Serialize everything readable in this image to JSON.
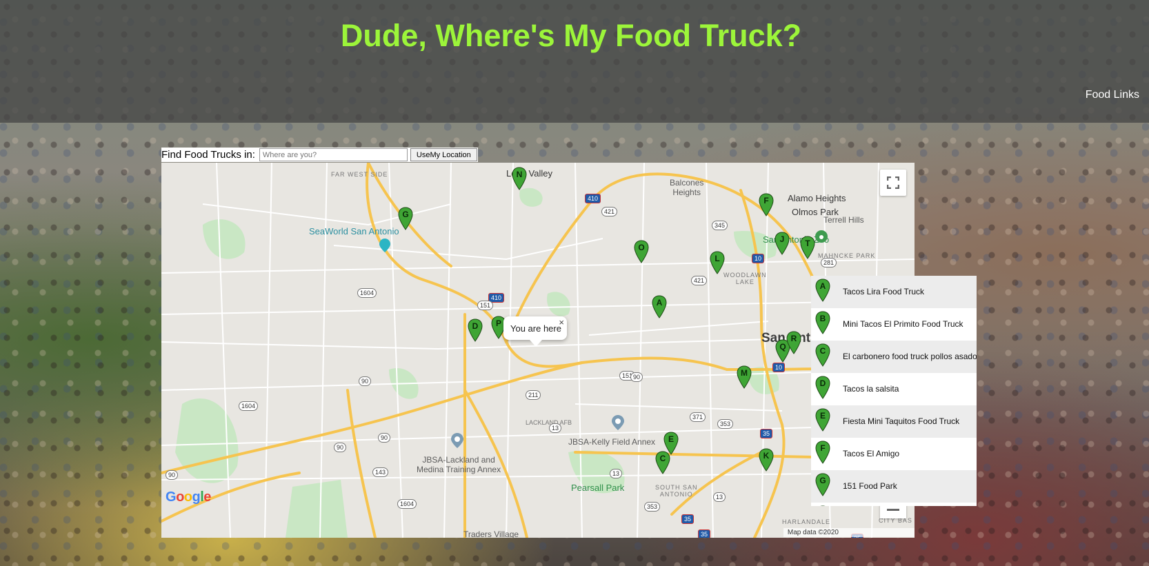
{
  "header": {
    "title": "Dude, Where's My Food Truck?",
    "nav_link": "Food Links"
  },
  "search": {
    "label": "Find Food Trucks in:",
    "placeholder": "Where are you?",
    "button": "UseMy Location"
  },
  "map": {
    "popup_text": "You are here",
    "popup_close": "×",
    "google": "Google",
    "attribution": "Map data ©2020",
    "labels": {
      "far_west_side": "FAR WEST SIDE",
      "leon_valley": "Leon Valley",
      "balcones_heights": "Balcones\nHeights",
      "alamo_heights": "Alamo Heights",
      "olmos_park": "Olmos Park",
      "terrell_hills": "Terrell Hills",
      "seaworld": "SeaWorld San Antonio",
      "zoo": "San Antonio Zoo",
      "mahncke": "MAHNCKE PARK",
      "woodlawn": "WOODLAWN\nLAKE",
      "san_antonio": "San Ant",
      "lackland_afb": "LACKLAND AFB",
      "jbsa_kelly": "JBSA-Kelly Field Annex",
      "jbsa_lackland": "JBSA-Lackland and\nMedina Training Annex",
      "pearsall": "Pearsall Park",
      "south_sa": "SOUTH SAN\nANTONIO",
      "harlandale": "HARLANDALE",
      "traders_village": "Traders Village",
      "city_base": "CITY BAS"
    },
    "shields": [
      "410",
      "410",
      "421",
      "345",
      "10",
      "281",
      "421",
      "151",
      "1604",
      "151",
      "90",
      "90",
      "1604",
      "211",
      "90",
      "90",
      "90",
      "143",
      "1604",
      "13",
      "13",
      "353",
      "371",
      "353",
      "35",
      "35",
      "10",
      "13",
      "35",
      "35"
    ],
    "markers": [
      "N",
      "F",
      "G",
      "O",
      "L",
      "J",
      "A",
      "D",
      "P",
      "M",
      "Q",
      "R",
      "E",
      "C",
      "K",
      "T"
    ]
  },
  "list": {
    "items": [
      {
        "letter": "A",
        "name": "Tacos Lira Food Truck"
      },
      {
        "letter": "B",
        "name": "Mini Tacos El Primito Food Truck"
      },
      {
        "letter": "C",
        "name": "El carbonero food truck pollos asado"
      },
      {
        "letter": "D",
        "name": "Tacos la salsita"
      },
      {
        "letter": "E",
        "name": "Fiesta Mini Taquitos Food Truck"
      },
      {
        "letter": "F",
        "name": "Tacos El Amigo"
      },
      {
        "letter": "G",
        "name": "151 Food Park"
      },
      {
        "letter": "H",
        "name": ""
      }
    ]
  },
  "colors": {
    "title": "#9cf53a",
    "pin": "#3fa535",
    "highway": "#f6c44f"
  }
}
